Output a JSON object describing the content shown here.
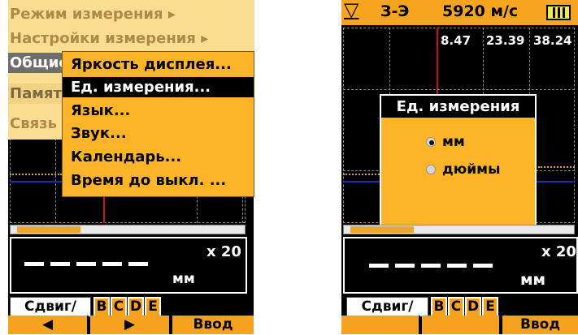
{
  "left": {
    "menu": {
      "items": [
        "Режим измерения ▸",
        "Настройки измерения ▸",
        "Общие",
        "Память",
        "Связь"
      ]
    },
    "submenu": {
      "items": [
        "Яркость дисплея...",
        "Ед. измерения...",
        "Язык...",
        "Звук...",
        "Календарь...",
        "Время до выкл. ..."
      ],
      "selected_index": 1
    },
    "panel": {
      "multiplier": "x 20",
      "reading": "------",
      "unit": "мм",
      "shift_label": "Сдвиг/разв.",
      "letters": [
        "B",
        "C",
        "D",
        "E"
      ]
    },
    "buttons": [
      "◀",
      "▶",
      "Ввод"
    ]
  },
  "right": {
    "header": {
      "gate_icon": "triangle-down-icon",
      "mode": "З-Э",
      "velocity": "5920 м/с",
      "battery": "battery-icon"
    },
    "values": [
      "8.47",
      "23.39",
      "38.24"
    ],
    "dialog": {
      "title": "Ед. измерения",
      "options": [
        "мм",
        "дюймы"
      ],
      "selected": "мм"
    },
    "panel": {
      "multiplier": "x 20",
      "reading": "------",
      "unit": "мм",
      "shift_label": "Сдвиг/разв.",
      "letters": [
        "B",
        "C",
        "D",
        "E"
      ]
    },
    "buttons": [
      "",
      "",
      "Ввод"
    ]
  },
  "colors": {
    "accent": "#f6a21f",
    "menu_bg": "#f8dd93",
    "selection": "#000000",
    "cursor_line": "#c4141c",
    "trace_blue": "#1a2fb0"
  }
}
